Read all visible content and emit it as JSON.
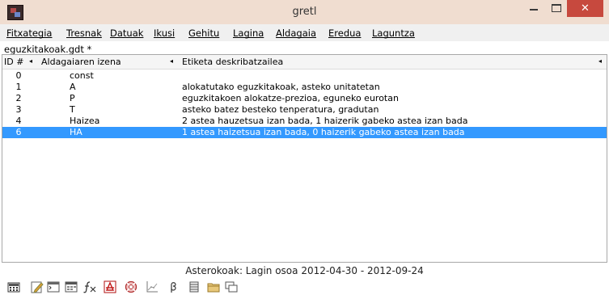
{
  "window": {
    "title": "gretl",
    "close_glyph": "✕"
  },
  "menu": [
    {
      "label": "Fitxategia"
    },
    {
      "label": "Tresnak"
    },
    {
      "label": "Datuak"
    },
    {
      "label": "Ikusi"
    },
    {
      "label": "Gehitu"
    },
    {
      "label": "Lagina"
    },
    {
      "label": "Aldagaia"
    },
    {
      "label": "Eredua"
    },
    {
      "label": "Laguntza"
    }
  ],
  "dataset": {
    "filename": "eguzkitakoak.gdt *"
  },
  "table": {
    "headers": {
      "id": "ID #",
      "name": "Aldagaiaren izena",
      "label": "Etiketa deskribatzailea",
      "sort_glyph": "◂"
    },
    "rows": [
      {
        "id": "0",
        "name": "const",
        "label": "",
        "selected": false
      },
      {
        "id": "1",
        "name": "A",
        "label": "alokatutako eguzkitakoak, asteko unitatetan",
        "selected": false
      },
      {
        "id": "2",
        "name": "P",
        "label": "eguzkitakoen alokatze-prezioa, eguneko eurotan",
        "selected": false
      },
      {
        "id": "3",
        "name": "T",
        "label": "asteko batez besteko tenperatura, gradutan",
        "selected": false
      },
      {
        "id": "4",
        "name": "Haizea",
        "label": "2 astea hauzetsua izan bada, 1 haizerik gabeko astea izan bada",
        "selected": false
      },
      {
        "id": "6",
        "name": "HA",
        "label": "1 astea haizetsua izan bada, 0 haizerik gabeko astea izan bada",
        "selected": true
      }
    ]
  },
  "status": {
    "text": "Asterokoak: Lagin osoa 2012-04-30 - 2012-09-24"
  },
  "toolbar_icons": [
    "calculator-icon",
    "edit-script-icon",
    "terminal-icon",
    "session-icon",
    "function-icon",
    "pdf-help-icon",
    "help-icon",
    "graph-icon",
    "beta-icon",
    "database-icon",
    "folder-icon",
    "windows-icon"
  ],
  "colors": {
    "titlebar": "#f0ddd0",
    "close_button": "#c7493e",
    "selection": "#3399ff"
  }
}
